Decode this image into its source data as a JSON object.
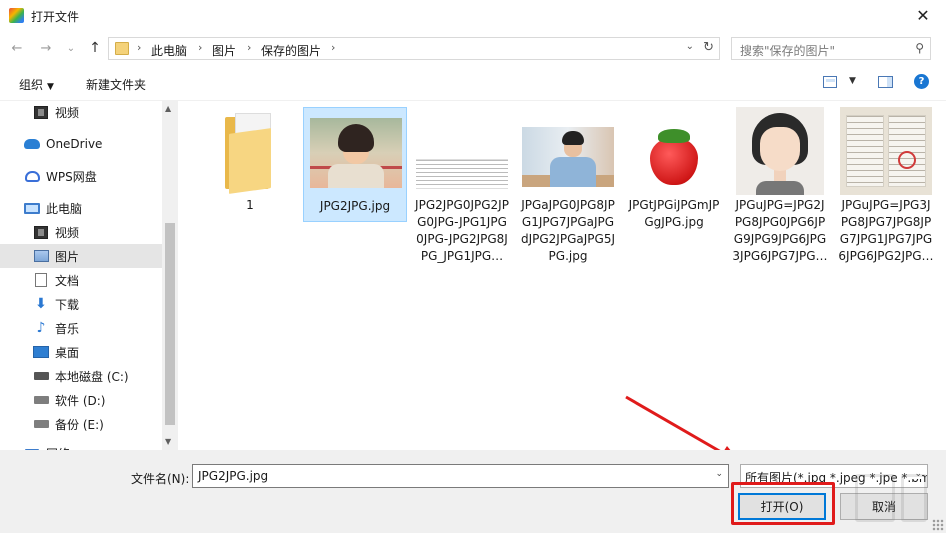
{
  "window": {
    "title": "打开文件",
    "close_glyph": "✕"
  },
  "nav": {
    "back": "←",
    "forward": "→",
    "dropdown": "⌄",
    "up": "↑"
  },
  "breadcrumb": {
    "items": [
      "此电脑",
      "图片",
      "保存的图片"
    ],
    "sep": "›",
    "dropdown": "⌄",
    "refresh": "↻"
  },
  "search": {
    "placeholder": "搜索\"保存的图片\"",
    "icon": "⚲"
  },
  "toolbar": {
    "organize": "组织",
    "organize_caret": "▼",
    "new_folder": "新建文件夹",
    "view_caret": "▼",
    "help": "?"
  },
  "sidebar": {
    "items": [
      {
        "label": "视频",
        "icon": "video-icon"
      },
      {
        "label": "OneDrive",
        "icon": "onedrive-icon"
      },
      {
        "label": "WPS网盘",
        "icon": "wps-cloud-icon"
      },
      {
        "label": "此电脑",
        "icon": "computer-icon"
      },
      {
        "label": "视频",
        "icon": "video-icon"
      },
      {
        "label": "图片",
        "icon": "pictures-icon"
      },
      {
        "label": "文档",
        "icon": "documents-icon"
      },
      {
        "label": "下载",
        "icon": "download-icon"
      },
      {
        "label": "音乐",
        "icon": "music-icon"
      },
      {
        "label": "桌面",
        "icon": "desktop-icon"
      },
      {
        "label": "本地磁盘 (C:)",
        "icon": "disk-icon"
      },
      {
        "label": "软件 (D:)",
        "icon": "disk-icon"
      },
      {
        "label": "备份 (E:)",
        "icon": "disk-icon"
      },
      {
        "label": "网络",
        "icon": "network-icon"
      }
    ],
    "scroll_up": "▲",
    "scroll_down": "▼",
    "glyph_down": "⬇",
    "glyph_music": "♪"
  },
  "files": [
    {
      "name": "1",
      "type": "folder"
    },
    {
      "name": "JPG2JPG.jpg",
      "type": "image",
      "selected": true
    },
    {
      "name": "JPG2JPG0JPG2JPG0JPG-JPG1JPG0JPG-JPG2JPG8JPG_JPG1JPG…",
      "type": "image"
    },
    {
      "name": "JPGaJPG0JPG8JPG1JPG7JPGaJPGdJPG2JPGaJPG5JPG.jpg",
      "type": "image"
    },
    {
      "name": "JPGtJPGiJPGmJPGgJPG.jpg",
      "type": "image"
    },
    {
      "name": "JPGuJPG=JPG2JPG8JPG0JPG6JPG9JPG9JPG6JPG3JPG6JPG7JPG…",
      "type": "image"
    },
    {
      "name": "JPGuJPG=JPG3JPG8JPG7JPG8JPG7JPG1JPG7JPG6JPG6JPG2JPG…",
      "type": "image"
    }
  ],
  "footer": {
    "filename_label": "文件名(N):",
    "filename_value": "JPG2JPG.jpg",
    "filter_value": "所有图片(*.jpg *.jpeg *.jpe *.bmp",
    "dropdown": "⌄",
    "open_label": "打开(O)",
    "cancel_label": "取消"
  },
  "colors": {
    "accent": "#0078d7",
    "selection": "#cce8ff",
    "annotation_red": "#e01b1b"
  }
}
